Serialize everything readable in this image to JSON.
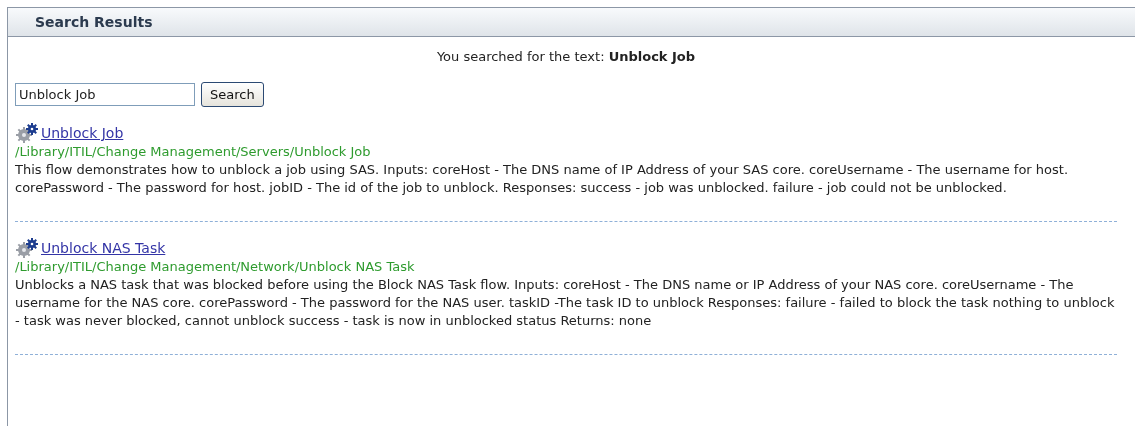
{
  "panel": {
    "title": "Search Results"
  },
  "summary": "You searched for the text: **Unblock Job**",
  "search": {
    "value": "Unblock Job",
    "button": "Search"
  },
  "results": [
    {
      "title": "Unblock Job",
      "path": "/Library/ITIL/Change Management/Servers/Unblock Job",
      "description": "This flow demonstrates how to unblock a job using SAS. Inputs: coreHost - The DNS name of IP Address of your SAS core. coreUsername - The username for host. corePassword - The password for host. jobID - The id of the job to unblock. Responses: success - job was unblocked. failure - job could not be unblocked."
    },
    {
      "title": "Unblock NAS Task",
      "path": "/Library/ITIL/Change Management/Network/Unblock NAS Task",
      "description": "Unblocks a NAS task that was blocked before using the Block NAS Task flow. Inputs: coreHost - The DNS name or IP Address of your NAS core. coreUsername - The username for the NAS core. corePassword - The password for the NAS user. taskID -The task ID to unblock Responses: failure - failed to block the task nothing to unblock - task was never blocked, cannot unblock success - task is now in unblocked status Returns: none"
    }
  ]
}
